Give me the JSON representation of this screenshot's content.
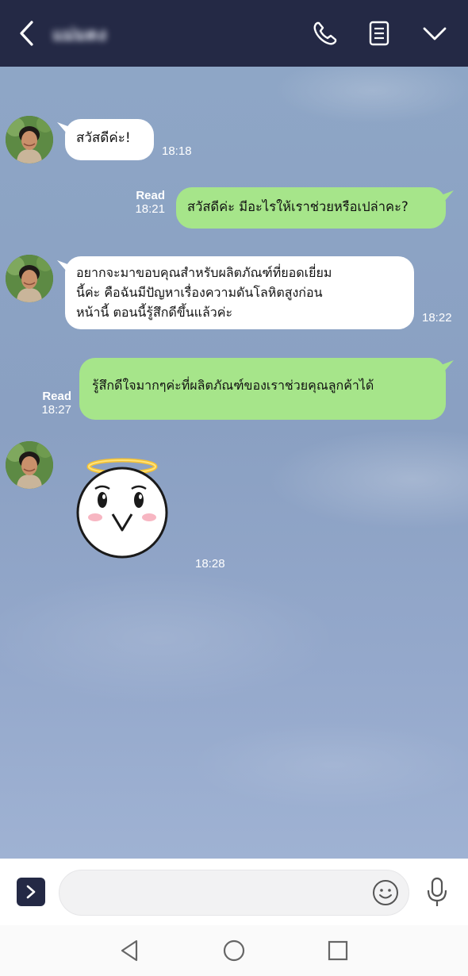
{
  "header": {
    "contact_name": "แม่มดง",
    "icons": [
      "back-icon",
      "call-icon",
      "notes-icon",
      "chevron-down-icon"
    ],
    "background_color": "#242945"
  },
  "messages": [
    {
      "from": "contact",
      "type": "text",
      "text": "สวัสดีค่ะ!",
      "time": "18:18"
    },
    {
      "from": "me",
      "type": "text",
      "text": "สวัสดีค่ะ มีอะไรให้เราช่วยหรือเปล่าคะ?",
      "read": "Read",
      "time": "18:21"
    },
    {
      "from": "contact",
      "type": "text",
      "lines": [
        "อยากจะมาขอบคุณสำหรับผลิตภัณฑ์ที่ยอดเยี่ยม",
        "นี้ค่ะ คือฉันมีปัญหาเรื่องความดันโลหิตสูงก่อน",
        "หน้านี้ ตอนนี้รู้สึกดีขึ้นแล้วค่ะ"
      ],
      "time": "18:22"
    },
    {
      "from": "me",
      "type": "text",
      "text": "รู้สึกดีใจมากๆค่ะที่ผลิตภัณฑ์ของเราช่วยคุณลูกค้าได้",
      "read": "Read",
      "time": "18:27"
    },
    {
      "from": "contact",
      "type": "sticker",
      "sticker": "angel-face-sticker",
      "time": "18:28"
    }
  ],
  "input": {
    "value": "",
    "placeholder": "",
    "icons": [
      "chevron-right-icon",
      "smiley-icon",
      "microphone-icon"
    ]
  },
  "navbar": {
    "icons": [
      "nav-back-icon",
      "nav-home-icon",
      "nav-recents-icon"
    ]
  },
  "colors": {
    "outgoing_bubble": "#a6e58a",
    "incoming_bubble": "#ffffff",
    "chat_background": "#8ea6c6"
  }
}
